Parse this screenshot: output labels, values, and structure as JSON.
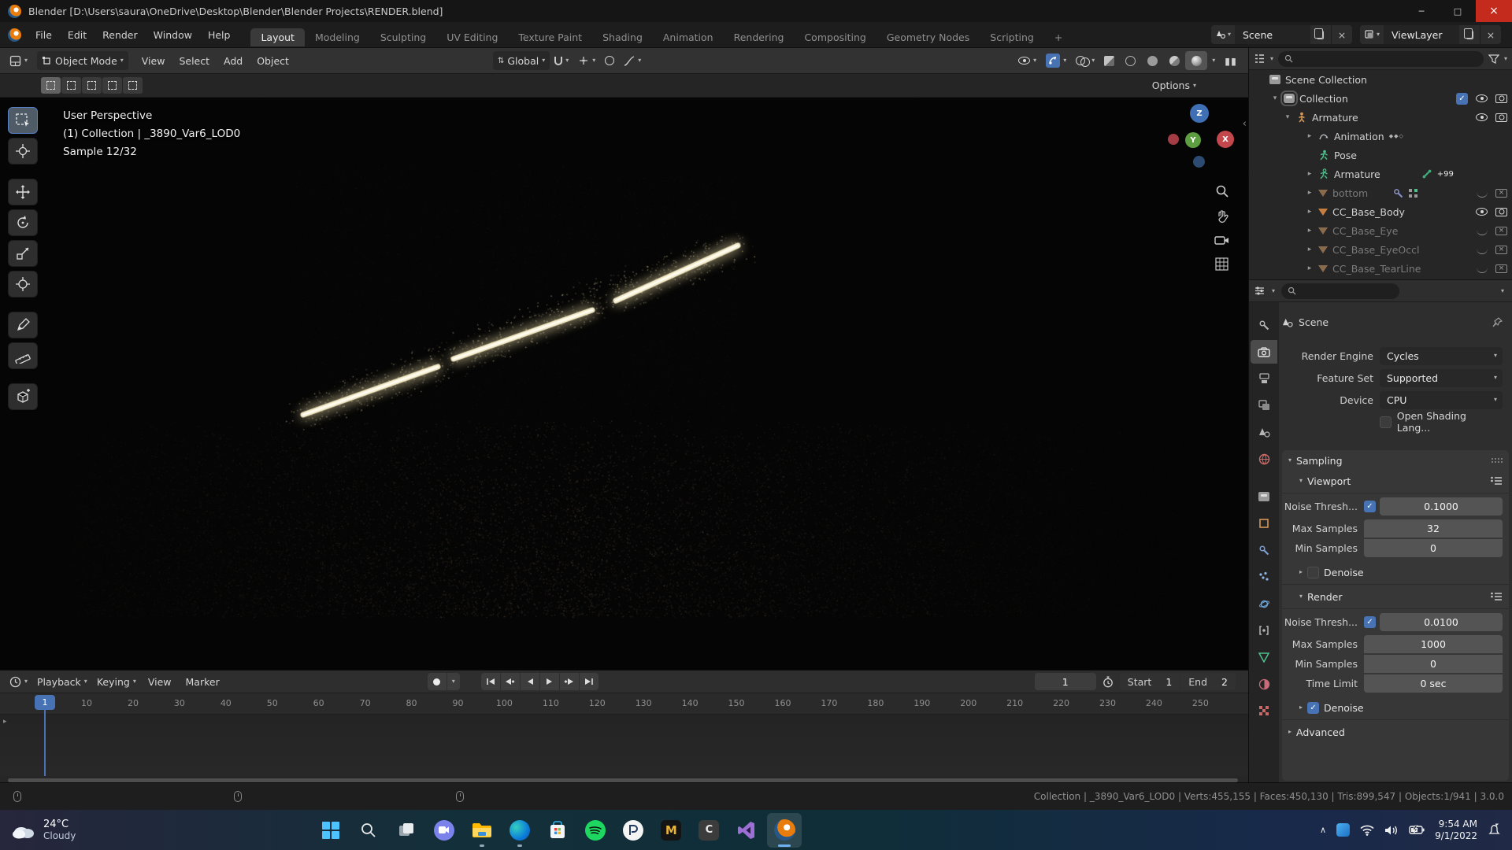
{
  "icons": {
    "chevron_down": "▾",
    "chevron_right": "▸",
    "chevron_up": "∧",
    "close": "×",
    "minimize": "─",
    "maximize": "□",
    "check": "✓",
    "plus": "+",
    "collapse_left": "‹"
  },
  "title_bar": {
    "title": "Blender [D:\\Users\\saura\\OneDrive\\Desktop\\Blender\\Blender Projects\\RENDER.blend]"
  },
  "menus": {
    "file": "File",
    "edit": "Edit",
    "render": "Render",
    "window": "Window",
    "help": "Help"
  },
  "workspace_tabs": {
    "layout": "Layout",
    "modeling": "Modeling",
    "sculpting": "Sculpting",
    "uv_editing": "UV Editing",
    "texture_paint": "Texture Paint",
    "shading": "Shading",
    "animation": "Animation",
    "rendering": "Rendering",
    "compositing": "Compositing",
    "geometry_nodes": "Geometry Nodes",
    "scripting": "Scripting"
  },
  "scene_selector": {
    "scene": "Scene",
    "view_layer": "ViewLayer"
  },
  "viewport_header": {
    "mode": "Object Mode",
    "view": "View",
    "select": "Select",
    "add": "Add",
    "object": "Object",
    "orientation": "Global"
  },
  "tool_settings": {
    "options": "Options"
  },
  "viewport_overlay": {
    "line1": "User Perspective",
    "line2": "(1) Collection | _3890_Var6_LOD0",
    "line3": "Sample 12/32"
  },
  "gizmo": {
    "x": "X",
    "y": "Y",
    "z": "Z"
  },
  "outliner": {
    "rows": [
      {
        "label": "Scene Collection"
      },
      {
        "label": "Collection"
      },
      {
        "label": "Armature"
      },
      {
        "label": "Animation"
      },
      {
        "label": "Pose"
      },
      {
        "label": "Armature",
        "badge": "99"
      },
      {
        "label": "bottom"
      },
      {
        "label": "CC_Base_Body"
      },
      {
        "label": "CC_Base_Eye"
      },
      {
        "label": "CC_Base_EyeOccl"
      },
      {
        "label": "CC_Base_TearLine"
      }
    ]
  },
  "properties": {
    "breadcrumb": "Scene",
    "render_engine_label": "Render Engine",
    "render_engine": "Cycles",
    "feature_set_label": "Feature Set",
    "feature_set": "Supported",
    "device_label": "Device",
    "device": "CPU",
    "osl_label": "Open Shading Lang...",
    "sampling": "Sampling",
    "viewport_section": "Viewport",
    "vp_noise_label": "Noise Thresh...",
    "vp_noise": "0.1000",
    "vp_max_label": "Max Samples",
    "vp_max": "32",
    "vp_min_label": "Min Samples",
    "vp_min": "0",
    "vp_denoise": "Denoise",
    "render_section": "Render",
    "r_noise_label": "Noise Thresh...",
    "r_noise": "0.0100",
    "r_max_label": "Max Samples",
    "r_max": "1000",
    "r_min_label": "Min Samples",
    "r_min": "0",
    "time_limit_label": "Time Limit",
    "time_limit": "0 sec",
    "r_denoise": "Denoise",
    "advanced": "Advanced"
  },
  "timeline": {
    "playback": "Playback",
    "keying": "Keying",
    "view": "View",
    "marker": "Marker",
    "current_frame": "1",
    "start_label": "Start",
    "start": "1",
    "end_label": "End",
    "end": "2",
    "ruler": [
      "1",
      "10",
      "20",
      "30",
      "40",
      "50",
      "60",
      "70",
      "80",
      "90",
      "100",
      "110",
      "120",
      "130",
      "140",
      "150",
      "160",
      "170",
      "180",
      "190",
      "200",
      "210",
      "220",
      "230",
      "240",
      "250"
    ]
  },
  "status_bar": {
    "info": "Collection | _3890_Var6_LOD0 | Verts:455,155 | Faces:450,130 | Tris:899,547 | Objects:1/941 | 3.0.0"
  },
  "taskbar": {
    "weather_temp": "24°C",
    "weather_desc": "Cloudy",
    "time": "9:54 AM",
    "date": "9/1/2022"
  }
}
